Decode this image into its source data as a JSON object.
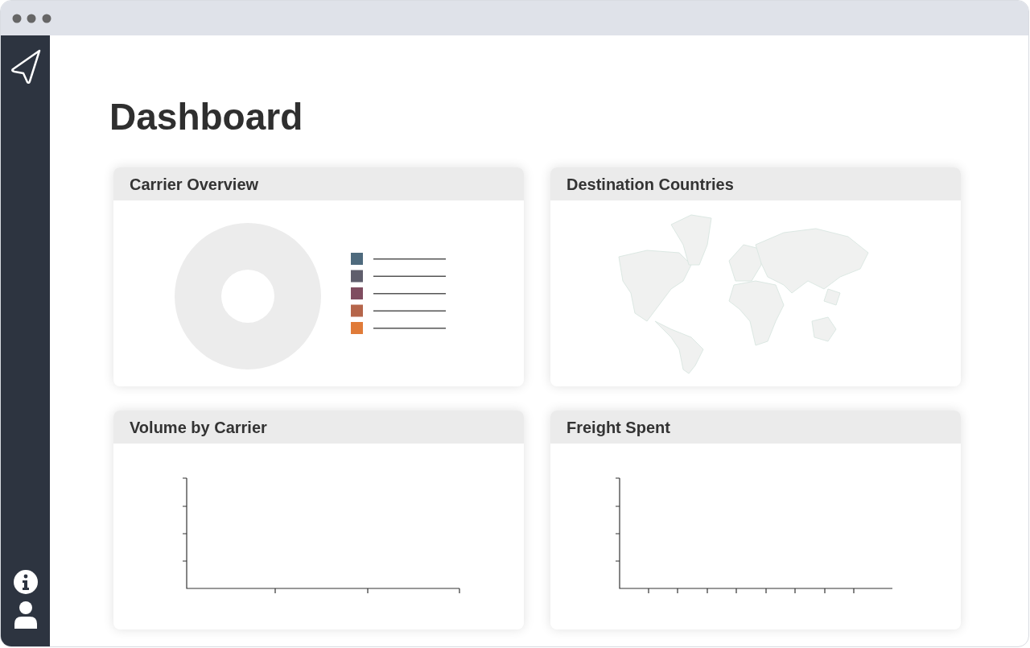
{
  "page": {
    "title": "Dashboard"
  },
  "cards": [
    {
      "title": "Carrier Overview",
      "kind": "donut",
      "legend": [
        {
          "color": "#4e6a7d"
        },
        {
          "color": "#5f5e6c"
        },
        {
          "color": "#7f4d60"
        },
        {
          "color": "#b5654a"
        },
        {
          "color": "#e07b39"
        }
      ]
    },
    {
      "title": "Destination Countries",
      "kind": "map"
    },
    {
      "title": "Volume by Carrier",
      "kind": "bar-axes"
    },
    {
      "title": "Freight Spent",
      "kind": "line-axes"
    }
  ]
}
